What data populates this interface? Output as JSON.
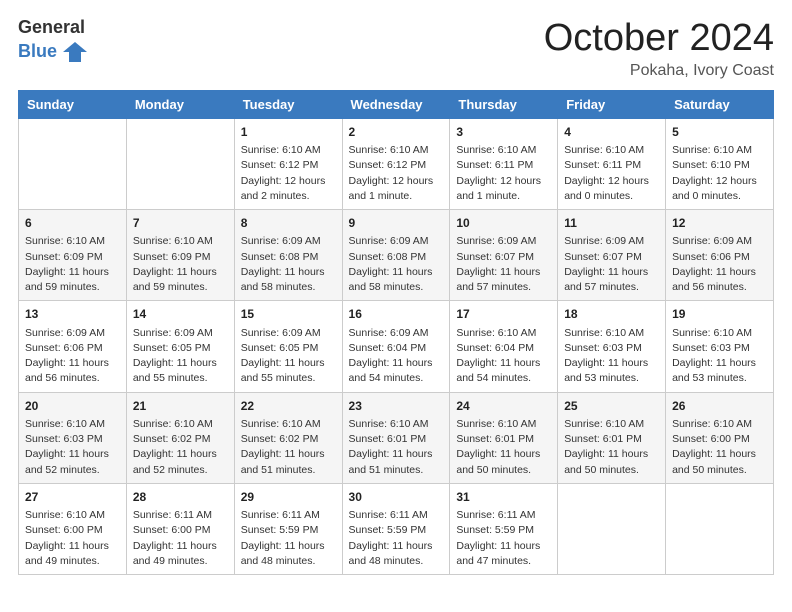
{
  "header": {
    "logo_general": "General",
    "logo_blue": "Blue",
    "month_title": "October 2024",
    "subtitle": "Pokaha, Ivory Coast"
  },
  "weekdays": [
    "Sunday",
    "Monday",
    "Tuesday",
    "Wednesday",
    "Thursday",
    "Friday",
    "Saturday"
  ],
  "rows": [
    [
      {
        "day": "",
        "lines": []
      },
      {
        "day": "",
        "lines": []
      },
      {
        "day": "1",
        "lines": [
          "Sunrise: 6:10 AM",
          "Sunset: 6:12 PM",
          "Daylight: 12 hours",
          "and 2 minutes."
        ]
      },
      {
        "day": "2",
        "lines": [
          "Sunrise: 6:10 AM",
          "Sunset: 6:12 PM",
          "Daylight: 12 hours",
          "and 1 minute."
        ]
      },
      {
        "day": "3",
        "lines": [
          "Sunrise: 6:10 AM",
          "Sunset: 6:11 PM",
          "Daylight: 12 hours",
          "and 1 minute."
        ]
      },
      {
        "day": "4",
        "lines": [
          "Sunrise: 6:10 AM",
          "Sunset: 6:11 PM",
          "Daylight: 12 hours",
          "and 0 minutes."
        ]
      },
      {
        "day": "5",
        "lines": [
          "Sunrise: 6:10 AM",
          "Sunset: 6:10 PM",
          "Daylight: 12 hours",
          "and 0 minutes."
        ]
      }
    ],
    [
      {
        "day": "6",
        "lines": [
          "Sunrise: 6:10 AM",
          "Sunset: 6:09 PM",
          "Daylight: 11 hours",
          "and 59 minutes."
        ]
      },
      {
        "day": "7",
        "lines": [
          "Sunrise: 6:10 AM",
          "Sunset: 6:09 PM",
          "Daylight: 11 hours",
          "and 59 minutes."
        ]
      },
      {
        "day": "8",
        "lines": [
          "Sunrise: 6:09 AM",
          "Sunset: 6:08 PM",
          "Daylight: 11 hours",
          "and 58 minutes."
        ]
      },
      {
        "day": "9",
        "lines": [
          "Sunrise: 6:09 AM",
          "Sunset: 6:08 PM",
          "Daylight: 11 hours",
          "and 58 minutes."
        ]
      },
      {
        "day": "10",
        "lines": [
          "Sunrise: 6:09 AM",
          "Sunset: 6:07 PM",
          "Daylight: 11 hours",
          "and 57 minutes."
        ]
      },
      {
        "day": "11",
        "lines": [
          "Sunrise: 6:09 AM",
          "Sunset: 6:07 PM",
          "Daylight: 11 hours",
          "and 57 minutes."
        ]
      },
      {
        "day": "12",
        "lines": [
          "Sunrise: 6:09 AM",
          "Sunset: 6:06 PM",
          "Daylight: 11 hours",
          "and 56 minutes."
        ]
      }
    ],
    [
      {
        "day": "13",
        "lines": [
          "Sunrise: 6:09 AM",
          "Sunset: 6:06 PM",
          "Daylight: 11 hours",
          "and 56 minutes."
        ]
      },
      {
        "day": "14",
        "lines": [
          "Sunrise: 6:09 AM",
          "Sunset: 6:05 PM",
          "Daylight: 11 hours",
          "and 55 minutes."
        ]
      },
      {
        "day": "15",
        "lines": [
          "Sunrise: 6:09 AM",
          "Sunset: 6:05 PM",
          "Daylight: 11 hours",
          "and 55 minutes."
        ]
      },
      {
        "day": "16",
        "lines": [
          "Sunrise: 6:09 AM",
          "Sunset: 6:04 PM",
          "Daylight: 11 hours",
          "and 54 minutes."
        ]
      },
      {
        "day": "17",
        "lines": [
          "Sunrise: 6:10 AM",
          "Sunset: 6:04 PM",
          "Daylight: 11 hours",
          "and 54 minutes."
        ]
      },
      {
        "day": "18",
        "lines": [
          "Sunrise: 6:10 AM",
          "Sunset: 6:03 PM",
          "Daylight: 11 hours",
          "and 53 minutes."
        ]
      },
      {
        "day": "19",
        "lines": [
          "Sunrise: 6:10 AM",
          "Sunset: 6:03 PM",
          "Daylight: 11 hours",
          "and 53 minutes."
        ]
      }
    ],
    [
      {
        "day": "20",
        "lines": [
          "Sunrise: 6:10 AM",
          "Sunset: 6:03 PM",
          "Daylight: 11 hours",
          "and 52 minutes."
        ]
      },
      {
        "day": "21",
        "lines": [
          "Sunrise: 6:10 AM",
          "Sunset: 6:02 PM",
          "Daylight: 11 hours",
          "and 52 minutes."
        ]
      },
      {
        "day": "22",
        "lines": [
          "Sunrise: 6:10 AM",
          "Sunset: 6:02 PM",
          "Daylight: 11 hours",
          "and 51 minutes."
        ]
      },
      {
        "day": "23",
        "lines": [
          "Sunrise: 6:10 AM",
          "Sunset: 6:01 PM",
          "Daylight: 11 hours",
          "and 51 minutes."
        ]
      },
      {
        "day": "24",
        "lines": [
          "Sunrise: 6:10 AM",
          "Sunset: 6:01 PM",
          "Daylight: 11 hours",
          "and 50 minutes."
        ]
      },
      {
        "day": "25",
        "lines": [
          "Sunrise: 6:10 AM",
          "Sunset: 6:01 PM",
          "Daylight: 11 hours",
          "and 50 minutes."
        ]
      },
      {
        "day": "26",
        "lines": [
          "Sunrise: 6:10 AM",
          "Sunset: 6:00 PM",
          "Daylight: 11 hours",
          "and 50 minutes."
        ]
      }
    ],
    [
      {
        "day": "27",
        "lines": [
          "Sunrise: 6:10 AM",
          "Sunset: 6:00 PM",
          "Daylight: 11 hours",
          "and 49 minutes."
        ]
      },
      {
        "day": "28",
        "lines": [
          "Sunrise: 6:11 AM",
          "Sunset: 6:00 PM",
          "Daylight: 11 hours",
          "and 49 minutes."
        ]
      },
      {
        "day": "29",
        "lines": [
          "Sunrise: 6:11 AM",
          "Sunset: 5:59 PM",
          "Daylight: 11 hours",
          "and 48 minutes."
        ]
      },
      {
        "day": "30",
        "lines": [
          "Sunrise: 6:11 AM",
          "Sunset: 5:59 PM",
          "Daylight: 11 hours",
          "and 48 minutes."
        ]
      },
      {
        "day": "31",
        "lines": [
          "Sunrise: 6:11 AM",
          "Sunset: 5:59 PM",
          "Daylight: 11 hours",
          "and 47 minutes."
        ]
      },
      {
        "day": "",
        "lines": []
      },
      {
        "day": "",
        "lines": []
      }
    ]
  ]
}
